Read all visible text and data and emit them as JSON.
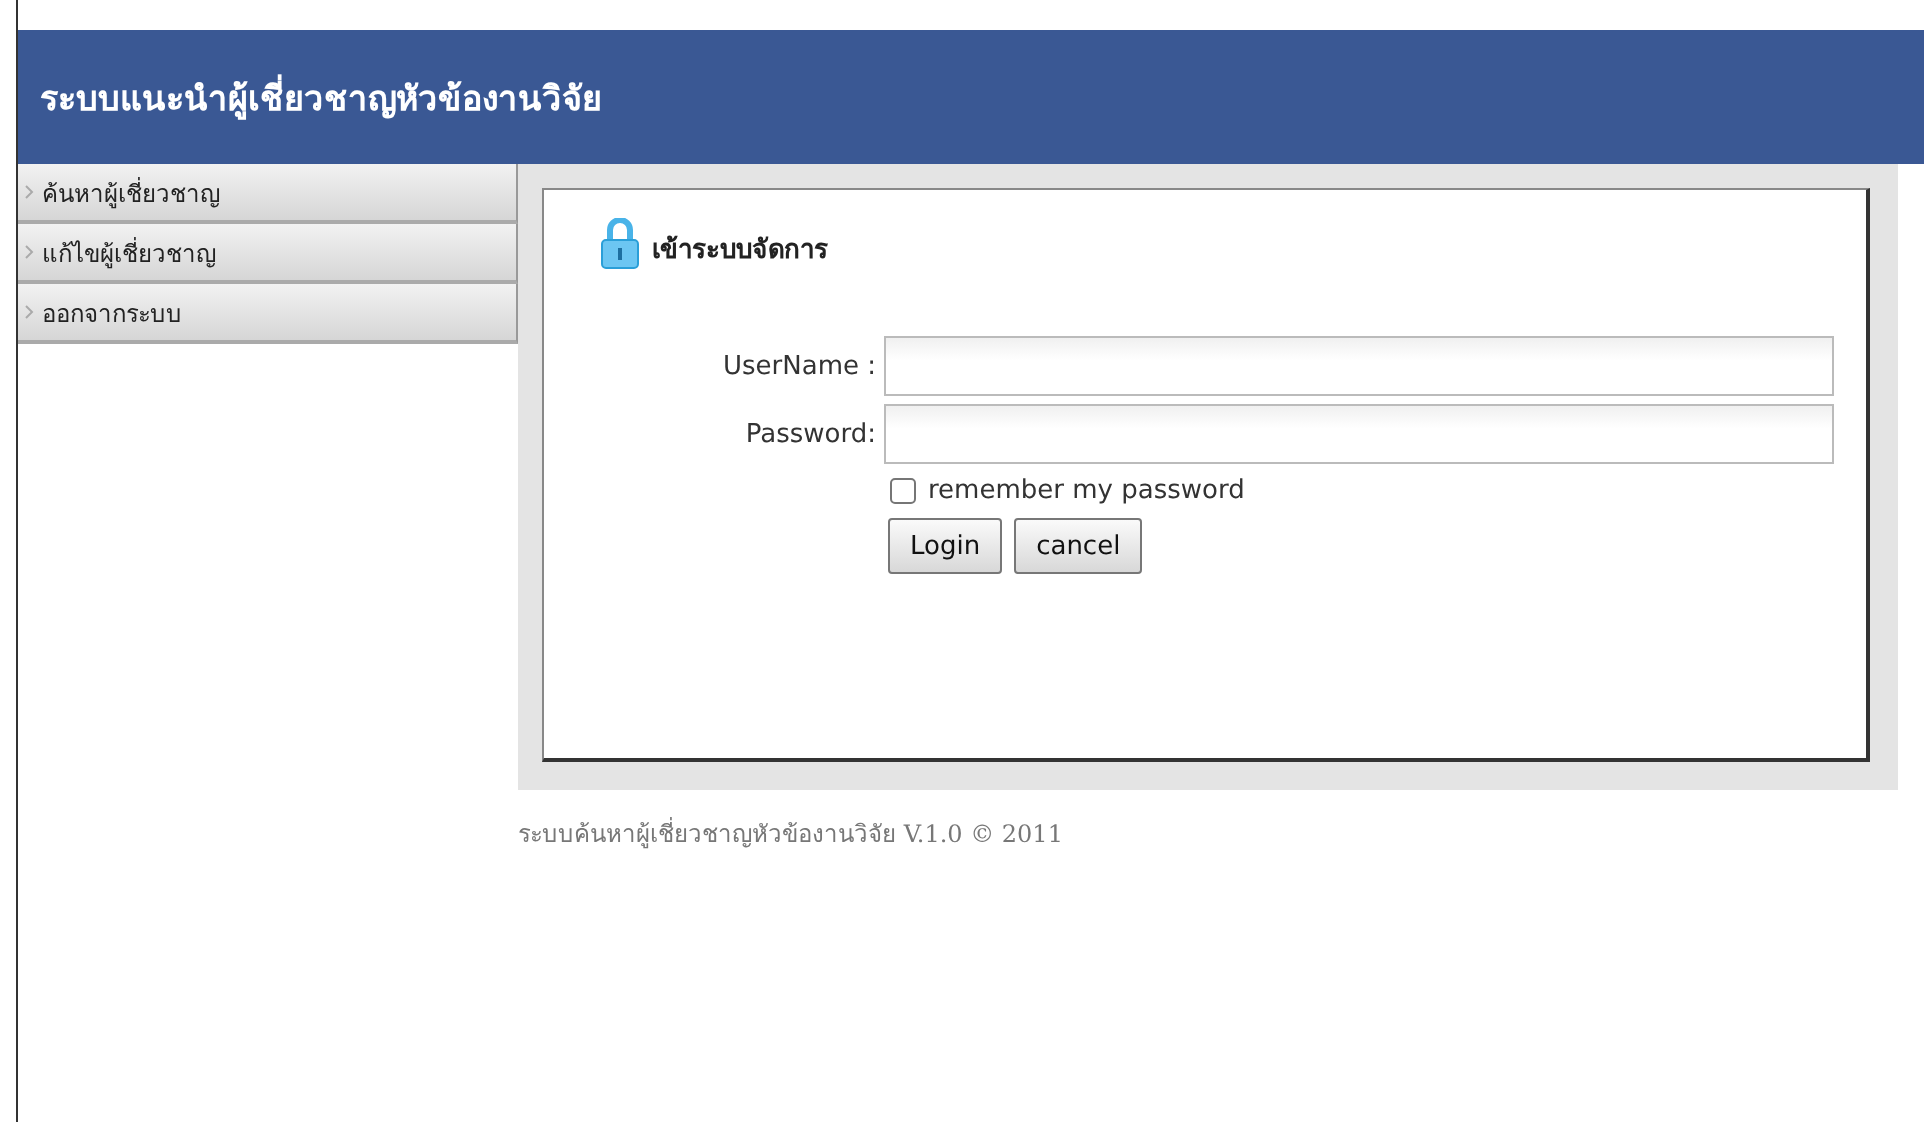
{
  "header": {
    "title": "ระบบแนะนำผู้เชี่ยวชาญหัวข้องานวิจัย"
  },
  "sidebar": {
    "items": [
      {
        "label": "ค้นหาผู้เชี่ยวชาญ"
      },
      {
        "label": "แก้ไขผู้เชี่ยวชาญ"
      },
      {
        "label": "ออกจากระบบ"
      }
    ]
  },
  "login": {
    "heading": "เข้าระบบจัดการ",
    "fields": [
      {
        "label": "UserName :"
      },
      {
        "label": "Password:"
      }
    ],
    "remember": {
      "label": "remember my password",
      "checked": false
    },
    "buttons": [
      "Login",
      "cancel"
    ]
  },
  "footer": {
    "text": "ระบบค้นหาผู้เชี่ยวชาญหัวข้องานวิจัย V.1.0 © 2011"
  }
}
